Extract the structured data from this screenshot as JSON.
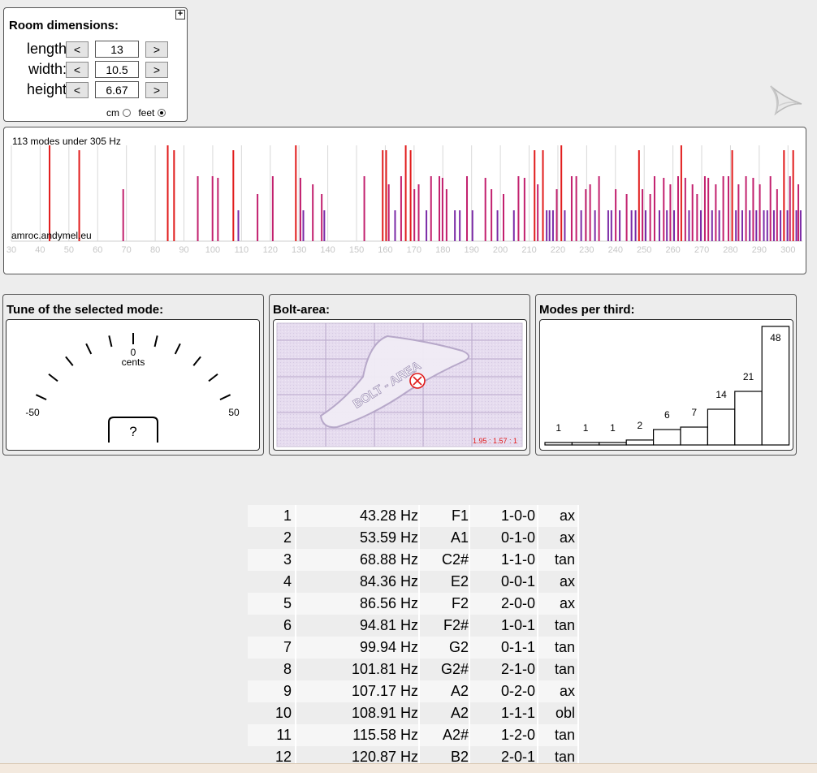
{
  "room": {
    "title": "Room dimensions:",
    "expand_glyph": "+",
    "fields": [
      {
        "label": "length",
        "value": "13",
        "dec": "<",
        "inc": ">"
      },
      {
        "label": "width:",
        "value": "10.5",
        "dec": "<",
        "inc": ">"
      },
      {
        "label": "height",
        "value": "6.67",
        "dec": "<",
        "inc": ">"
      }
    ],
    "units": {
      "cm": "cm",
      "feet": "feet",
      "selected": "feet"
    }
  },
  "logo_icon": "speaker-cone-icon",
  "spectrum": {
    "summary": "113 modes under 305 Hz",
    "watermark": "amroc.andymel.eu",
    "axis_min": 30,
    "axis_max": 305,
    "ticks": [
      "30",
      "40",
      "50",
      "60",
      "70",
      "80",
      "90",
      "100",
      "110",
      "120",
      "130",
      "140",
      "150",
      "160",
      "170",
      "180",
      "190",
      "200",
      "210",
      "220",
      "230",
      "240",
      "250",
      "260",
      "270",
      "280",
      "290",
      "300"
    ],
    "colors": {
      "ax": "#e11b1b",
      "tan": "#c2206e",
      "obl": "#7b2aa6",
      "grid": "#d8d8d8"
    },
    "mode_lines": [
      {
        "f": 43.28,
        "type": "ax"
      },
      {
        "f": 53.59,
        "type": "ax"
      },
      {
        "f": 68.88,
        "type": "tan"
      },
      {
        "f": 84.36,
        "type": "ax"
      },
      {
        "f": 86.56,
        "type": "ax"
      },
      {
        "f": 94.81,
        "type": "tan"
      },
      {
        "f": 99.94,
        "type": "tan"
      },
      {
        "f": 101.81,
        "type": "tan"
      },
      {
        "f": 107.17,
        "type": "ax"
      },
      {
        "f": 108.91,
        "type": "obl"
      },
      {
        "f": 115.58,
        "type": "tan"
      },
      {
        "f": 120.87,
        "type": "tan"
      },
      {
        "f": 128.9,
        "type": "ax"
      },
      {
        "f": 130.5,
        "type": "tan"
      },
      {
        "f": 131.5,
        "type": "obl"
      },
      {
        "f": 134.8,
        "type": "tan"
      },
      {
        "f": 137.9,
        "type": "tan"
      },
      {
        "f": 138.8,
        "type": "obl"
      },
      {
        "f": 152.7,
        "type": "tan"
      },
      {
        "f": 159.1,
        "type": "ax"
      },
      {
        "f": 160.3,
        "type": "ax"
      },
      {
        "f": 161.2,
        "type": "tan"
      },
      {
        "f": 163.4,
        "type": "obl"
      },
      {
        "f": 165.5,
        "type": "tan"
      },
      {
        "f": 167.1,
        "type": "ax"
      },
      {
        "f": 168.8,
        "type": "ax"
      },
      {
        "f": 170.1,
        "type": "tan"
      },
      {
        "f": 171.6,
        "type": "tan"
      },
      {
        "f": 174.3,
        "type": "obl"
      },
      {
        "f": 175.9,
        "type": "tan"
      },
      {
        "f": 178.8,
        "type": "tan"
      },
      {
        "f": 179.9,
        "type": "tan"
      },
      {
        "f": 181.3,
        "type": "tan"
      },
      {
        "f": 184.2,
        "type": "obl"
      },
      {
        "f": 185.9,
        "type": "obl"
      },
      {
        "f": 188.4,
        "type": "tan"
      },
      {
        "f": 190.3,
        "type": "obl"
      },
      {
        "f": 194.8,
        "type": "tan"
      },
      {
        "f": 196.9,
        "type": "tan"
      },
      {
        "f": 199.0,
        "type": "obl"
      },
      {
        "f": 201.1,
        "type": "tan"
      },
      {
        "f": 204.7,
        "type": "obl"
      },
      {
        "f": 206.3,
        "type": "tan"
      },
      {
        "f": 208.4,
        "type": "tan"
      },
      {
        "f": 211.9,
        "type": "ax"
      },
      {
        "f": 213.0,
        "type": "tan"
      },
      {
        "f": 214.8,
        "type": "ax"
      },
      {
        "f": 216.1,
        "type": "obl"
      },
      {
        "f": 217.1,
        "type": "obl"
      },
      {
        "f": 218.3,
        "type": "obl"
      },
      {
        "f": 219.6,
        "type": "tan"
      },
      {
        "f": 221.2,
        "type": "ax"
      },
      {
        "f": 222.4,
        "type": "obl"
      },
      {
        "f": 224.8,
        "type": "tan"
      },
      {
        "f": 226.4,
        "type": "tan"
      },
      {
        "f": 228.1,
        "type": "obl"
      },
      {
        "f": 229.7,
        "type": "tan"
      },
      {
        "f": 231.2,
        "type": "tan"
      },
      {
        "f": 232.9,
        "type": "obl"
      },
      {
        "f": 234.3,
        "type": "tan"
      },
      {
        "f": 237.5,
        "type": "obl"
      },
      {
        "f": 238.6,
        "type": "obl"
      },
      {
        "f": 240.1,
        "type": "tan"
      },
      {
        "f": 241.5,
        "type": "obl"
      },
      {
        "f": 243.9,
        "type": "tan"
      },
      {
        "f": 245.6,
        "type": "obl"
      },
      {
        "f": 247.0,
        "type": "obl"
      },
      {
        "f": 248.2,
        "type": "ax"
      },
      {
        "f": 249.4,
        "type": "tan"
      },
      {
        "f": 250.5,
        "type": "obl"
      },
      {
        "f": 252.1,
        "type": "tan"
      },
      {
        "f": 253.6,
        "type": "tan"
      },
      {
        "f": 255.3,
        "type": "obl"
      },
      {
        "f": 256.8,
        "type": "tan"
      },
      {
        "f": 257.9,
        "type": "obl"
      },
      {
        "f": 259.1,
        "type": "tan"
      },
      {
        "f": 260.4,
        "type": "obl"
      },
      {
        "f": 261.8,
        "type": "tan"
      },
      {
        "f": 262.9,
        "type": "ax"
      },
      {
        "f": 264.3,
        "type": "tan"
      },
      {
        "f": 265.6,
        "type": "obl"
      },
      {
        "f": 266.8,
        "type": "tan"
      },
      {
        "f": 268.4,
        "type": "tan"
      },
      {
        "f": 269.7,
        "type": "obl"
      },
      {
        "f": 271.1,
        "type": "tan"
      },
      {
        "f": 272.3,
        "type": "tan"
      },
      {
        "f": 273.6,
        "type": "obl"
      },
      {
        "f": 274.9,
        "type": "tan"
      },
      {
        "f": 276.1,
        "type": "obl"
      },
      {
        "f": 277.5,
        "type": "tan"
      },
      {
        "f": 279.3,
        "type": "tan"
      },
      {
        "f": 280.6,
        "type": "ax"
      },
      {
        "f": 281.9,
        "type": "obl"
      },
      {
        "f": 282.8,
        "type": "tan"
      },
      {
        "f": 284.1,
        "type": "obl"
      },
      {
        "f": 285.4,
        "type": "tan"
      },
      {
        "f": 286.7,
        "type": "obl"
      },
      {
        "f": 287.9,
        "type": "tan"
      },
      {
        "f": 289.0,
        "type": "obl"
      },
      {
        "f": 290.2,
        "type": "tan"
      },
      {
        "f": 291.6,
        "type": "obl"
      },
      {
        "f": 292.8,
        "type": "obl"
      },
      {
        "f": 293.9,
        "type": "tan"
      },
      {
        "f": 295.1,
        "type": "obl"
      },
      {
        "f": 296.2,
        "type": "tan"
      },
      {
        "f": 297.4,
        "type": "obl"
      },
      {
        "f": 298.6,
        "type": "ax"
      },
      {
        "f": 299.8,
        "type": "obl"
      },
      {
        "f": 300.7,
        "type": "tan"
      },
      {
        "f": 301.8,
        "type": "ax"
      },
      {
        "f": 302.9,
        "type": "obl"
      },
      {
        "f": 303.6,
        "type": "tan"
      },
      {
        "f": 304.4,
        "type": "obl"
      }
    ]
  },
  "tune": {
    "title": "Tune of the selected mode:",
    "center_label": "0",
    "unit_label": "cents",
    "min_label": "-50",
    "max_label": "50",
    "readout": "?"
  },
  "bolt": {
    "title": "Bolt-area:",
    "watermark": "BOLT - AREA",
    "ratio": "1.95 : 1.57 : 1",
    "marker_icon": "x-circle-icon"
  },
  "third": {
    "title": "Modes per third:",
    "chart_data": {
      "type": "bar",
      "values": [
        1,
        1,
        1,
        2,
        6,
        7,
        14,
        21,
        48
      ],
      "ylim": [
        0,
        48
      ]
    }
  },
  "modes_table": [
    {
      "idx": "1",
      "freq": "43.28 Hz",
      "note": "F1",
      "mode": "1-0-0",
      "type": "ax"
    },
    {
      "idx": "2",
      "freq": "53.59 Hz",
      "note": "A1",
      "mode": "0-1-0",
      "type": "ax"
    },
    {
      "idx": "3",
      "freq": "68.88 Hz",
      "note": "C2#",
      "mode": "1-1-0",
      "type": "tan"
    },
    {
      "idx": "4",
      "freq": "84.36 Hz",
      "note": "E2",
      "mode": "0-0-1",
      "type": "ax"
    },
    {
      "idx": "5",
      "freq": "86.56 Hz",
      "note": "F2",
      "mode": "2-0-0",
      "type": "ax"
    },
    {
      "idx": "6",
      "freq": "94.81 Hz",
      "note": "F2#",
      "mode": "1-0-1",
      "type": "tan"
    },
    {
      "idx": "7",
      "freq": "99.94 Hz",
      "note": "G2",
      "mode": "0-1-1",
      "type": "tan"
    },
    {
      "idx": "8",
      "freq": "101.81 Hz",
      "note": "G2#",
      "mode": "2-1-0",
      "type": "tan"
    },
    {
      "idx": "9",
      "freq": "107.17 Hz",
      "note": "A2",
      "mode": "0-2-0",
      "type": "ax"
    },
    {
      "idx": "10",
      "freq": "108.91 Hz",
      "note": "A2",
      "mode": "1-1-1",
      "type": "obl"
    },
    {
      "idx": "11",
      "freq": "115.58 Hz",
      "note": "A2#",
      "mode": "1-2-0",
      "type": "tan"
    },
    {
      "idx": "12",
      "freq": "120.87 Hz",
      "note": "B2",
      "mode": "2-0-1",
      "type": "tan"
    }
  ]
}
